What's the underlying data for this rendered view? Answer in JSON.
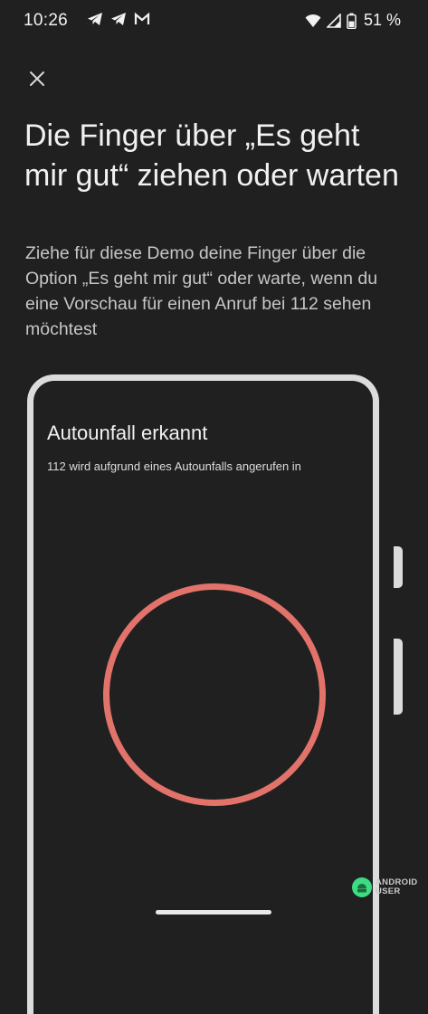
{
  "status_bar": {
    "time": "10:26",
    "left_icons": [
      "telegram-icon",
      "telegram-icon",
      "gmail-icon"
    ],
    "right_icons": [
      "wifi-icon",
      "signal-icon",
      "battery-icon"
    ],
    "battery": "51 %"
  },
  "header": {
    "close_icon": "close-icon",
    "title": "Die Finger über „Es geht mir gut“ ziehen oder warten",
    "description": "Ziehe für diese Demo deine Finger über die Option „Es geht mir gut“ oder warte, wenn du eine Vorschau für einen Anruf bei 112 sehen möchtest"
  },
  "demo_phone": {
    "title": "Autounfall erkannt",
    "subtitle": "112 wird aufgrund eines Autounfalls angerufen in",
    "ring_color": "#e2736a"
  },
  "watermark": {
    "line1": "ANDROID",
    "line2": "USER"
  },
  "colors": {
    "background": "#202020",
    "frame": "#dcdcdc",
    "accent": "#e2736a"
  }
}
